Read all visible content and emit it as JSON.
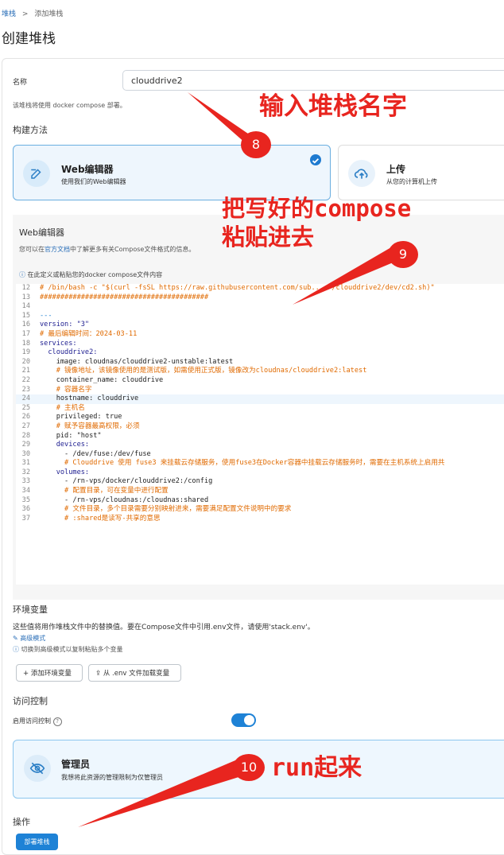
{
  "breadcrumb": {
    "root": "堆栈",
    "separator": ">",
    "current": "添加堆栈"
  },
  "page_title": "创建堆栈",
  "name_field": {
    "label": "名称",
    "value": "clouddrive2"
  },
  "compose_hint": "该堆栈将使用 docker compose 部署。",
  "build_method": {
    "title": "构建方法",
    "web": {
      "title": "Web编辑器",
      "subtitle": "使用我们的Web编辑器"
    },
    "upload": {
      "title": "上传",
      "subtitle": "从您的计算机上传"
    }
  },
  "editor": {
    "title": "Web编辑器",
    "desc_pre": "您可以在",
    "desc_link": "官方文档",
    "desc_post": "中了解更多有关Compose文件格式的信息。",
    "info": "在此定义或粘贴您的docker compose文件内容",
    "lines": [
      {
        "n": "12",
        "t": "# /bin/bash -c \"$(curl -fsSL https://raw.githubusercontent.com/sub...  /clouddrive2/dev/cd2.sh)\"",
        "c": "hash"
      },
      {
        "n": "13",
        "t": "#########################################",
        "c": "hash"
      },
      {
        "n": "14",
        "t": "",
        "c": "val"
      },
      {
        "n": "15",
        "t": "---",
        "c": "kw"
      },
      {
        "n": "16",
        "t": "version: \"3\"",
        "c": "mix-version"
      },
      {
        "n": "17",
        "t": "# 最后编辑时间：2024-03-11",
        "c": "com"
      },
      {
        "n": "18",
        "t": "services:",
        "c": "key"
      },
      {
        "n": "19",
        "t": "  clouddrive2:",
        "c": "key"
      },
      {
        "n": "20",
        "t": "    image: cloudnas/clouddrive2-unstable:latest",
        "c": "val"
      },
      {
        "n": "21",
        "t": "    # 镜像地址，该镜像使用的是测试版，如需使用正式版，镜像改为cloudnas/clouddrive2:latest",
        "c": "com"
      },
      {
        "n": "22",
        "t": "    container_name: clouddrive",
        "c": "val"
      },
      {
        "n": "23",
        "t": "    # 容器名字",
        "c": "com"
      },
      {
        "n": "24",
        "t": "    hostname: clouddrive",
        "c": "val"
      },
      {
        "n": "25",
        "t": "    # 主机名",
        "c": "com"
      },
      {
        "n": "26",
        "t": "    privileged: true",
        "c": "val"
      },
      {
        "n": "27",
        "t": "    # 赋予容器最高权限，必须",
        "c": "com"
      },
      {
        "n": "28",
        "t": "    pid: \"host\"",
        "c": "val"
      },
      {
        "n": "29",
        "t": "    devices:",
        "c": "key"
      },
      {
        "n": "30",
        "t": "      - /dev/fuse:/dev/fuse",
        "c": "val"
      },
      {
        "n": "31",
        "t": "      # Clouddrive 使用 fuse3 来挂载云存储服务，使用fuse3在Docker容器中挂载云存储服务时，需要在主机系统上启用共",
        "c": "com"
      },
      {
        "n": "32",
        "t": "    volumes:",
        "c": "key"
      },
      {
        "n": "33",
        "t": "      - /rn-vps/docker/clouddrive2:/config",
        "c": "val"
      },
      {
        "n": "34",
        "t": "      # 配置目录，可在变量中进行配置",
        "c": "com"
      },
      {
        "n": "35",
        "t": "      - /rn-vps/cloudnas:/cloudnas:shared",
        "c": "val"
      },
      {
        "n": "36",
        "t": "      # 文件目录，多个目录需要分别映射进来，需要满足配置文件说明中的要求",
        "c": "com"
      },
      {
        "n": "37",
        "t": "      # :shared是读写-共享的意思",
        "c": "com"
      }
    ]
  },
  "env": {
    "title": "环境变量",
    "desc": "这些值将用作堆栈文件中的替换值。要在Compose文件中引用.env文件，请使用'stack.env'。",
    "advanced": "高级模式",
    "advanced_hint": "切换到高级模式以复制粘贴多个变量",
    "add_button": "+ 添加环境变量",
    "load_button": "从 .env 文件加载变量"
  },
  "access": {
    "title": "访问控制",
    "toggle_label": "启用访问控制",
    "toggle_on": true,
    "admin_title": "管理员",
    "admin_sub": "我想将此资源的管理限制为仅管理员"
  },
  "actions": {
    "title": "操作",
    "deploy": "部署堆栈"
  },
  "annotations": {
    "a8_text": "输入堆栈名字",
    "a8_num": "8",
    "a9_text1": "把写好的compose",
    "a9_text2": "粘贴进去",
    "a9_num": "9",
    "a10_text": "run起来",
    "a10_num": "10"
  },
  "colors": {
    "accent": "#1e82d6",
    "annotation": "#e8251f"
  }
}
